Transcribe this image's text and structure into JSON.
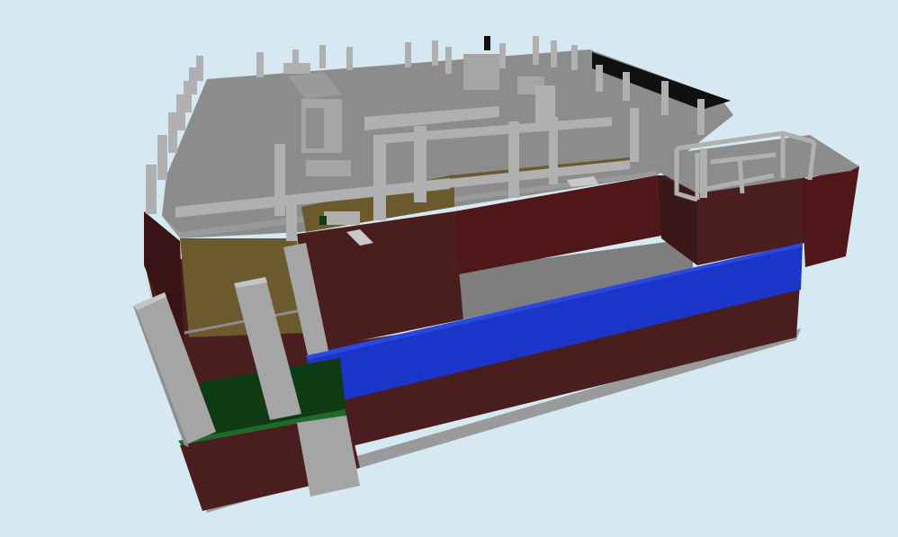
{
  "viewer": {
    "background_color": "#d6e9f3",
    "model_colors": {
      "wall": "#4a1e1f",
      "wall_light": "#5a2322",
      "wall_dark": "#3a1414",
      "slab": "#8c8c8c",
      "slab_top": "#909090",
      "column": "#b0b0b0",
      "column_shade": "#9a9a9a",
      "floor": "#6b5a2e",
      "water": "#1a35c8",
      "glass": "#0e3b14",
      "roof_dark": "#101010"
    }
  }
}
